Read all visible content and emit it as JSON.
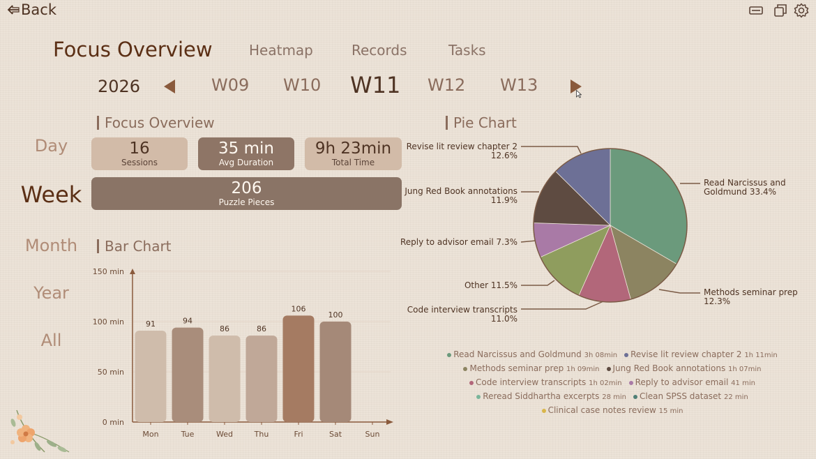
{
  "back_label": "Back",
  "title": "Focus Overview",
  "nav_tabs": [
    "Heatmap",
    "Records",
    "Tasks"
  ],
  "year": "2026",
  "weeks": [
    "W09",
    "W10",
    "W11",
    "W12",
    "W13"
  ],
  "active_week": "W11",
  "periods": [
    "Day",
    "Week",
    "Month",
    "Year",
    "All"
  ],
  "active_period": "Week",
  "focus_section_title": "Focus Overview",
  "stats": [
    {
      "value": "16",
      "label": "Sessions",
      "color": "#d2bba8"
    },
    {
      "value": "35 min",
      "label": "Avg Duration",
      "color": "#8e7566"
    },
    {
      "value": "9h 23min",
      "label": "Total Time",
      "color": "#d2bba8"
    }
  ],
  "puzzle": {
    "value": "206",
    "label": "Puzzle Pieces",
    "color": "#8a7466"
  },
  "bar_section_title": "Bar Chart",
  "pie_section_title": "Pie Chart",
  "chart_data": [
    {
      "type": "bar",
      "categories": [
        "Mon",
        "Tue",
        "Wed",
        "Thu",
        "Fri",
        "Sat",
        "Sun"
      ],
      "values": [
        91,
        94,
        86,
        86,
        106,
        100,
        0
      ],
      "data_labels": [
        "91",
        "94",
        "86",
        "86",
        "106",
        "100",
        ""
      ],
      "bar_colors": [
        "#cfbcab",
        "#a98d7b",
        "#cfbcab",
        "#c0a898",
        "#a57b62",
        "#a58978",
        "#cfbcab"
      ],
      "yticks": [
        0,
        50,
        100,
        150
      ],
      "ytick_labels": [
        "0 min",
        "50 min",
        "100 min",
        "150 min"
      ],
      "ylim": [
        0,
        150
      ]
    },
    {
      "type": "pie",
      "slices": [
        {
          "label": "Read Narcissus and Goldmund",
          "percent": 33.4,
          "color": "#6b9a7c"
        },
        {
          "label": "Methods seminar prep",
          "percent": 12.3,
          "color": "#8c8461"
        },
        {
          "label": "Code interview transcripts",
          "percent": 11.0,
          "color": "#b2677a"
        },
        {
          "label": "Other",
          "percent": 11.5,
          "color": "#8f9d5e"
        },
        {
          "label": "Reply to advisor email",
          "percent": 7.3,
          "color": "#a97aa6"
        },
        {
          "label": "Jung Red Book annotations",
          "percent": 11.9,
          "color": "#5e4b41"
        },
        {
          "label": "Revise lit review chapter 2",
          "percent": 12.6,
          "color": "#6d7096"
        }
      ],
      "callouts": {
        "read": [
          "Read Narcissus and",
          "Goldmund  33.4%"
        ],
        "methods": [
          "Methods seminar prep",
          "12.3%"
        ],
        "code": [
          "Code interview transcripts",
          "11.0%"
        ],
        "other": "Other  11.5%",
        "reply": "Reply to advisor email  7.3%",
        "jung": [
          "Jung Red Book annotations",
          "11.9%"
        ],
        "revise": [
          "Revise lit review chapter 2",
          "12.6%"
        ]
      }
    }
  ],
  "legend": [
    [
      {
        "name": "Read Narcissus and Goldmund",
        "time": "3h 08min",
        "color": "#6b9a7c"
      },
      {
        "name": "Revise lit review chapter 2",
        "time": "1h 11min",
        "color": "#6d7096"
      }
    ],
    [
      {
        "name": "Methods seminar prep",
        "time": "1h 09min",
        "color": "#8c8461"
      },
      {
        "name": "Jung Red Book annotations",
        "time": "1h 07min",
        "color": "#5e4b41"
      }
    ],
    [
      {
        "name": "Code interview transcripts",
        "time": "1h 02min",
        "color": "#b2677a"
      },
      {
        "name": "Reply to advisor email",
        "time": "41 min",
        "color": "#a97aa6"
      }
    ],
    [
      {
        "name": "Reread Siddhartha excerpts",
        "time": "28 min",
        "color": "#7ab59a"
      },
      {
        "name": "Clean SPSS dataset",
        "time": "22 min",
        "color": "#4f7f76"
      }
    ],
    [
      {
        "name": "Clinical case notes review",
        "time": "15 min",
        "color": "#d9b64a"
      }
    ]
  ]
}
